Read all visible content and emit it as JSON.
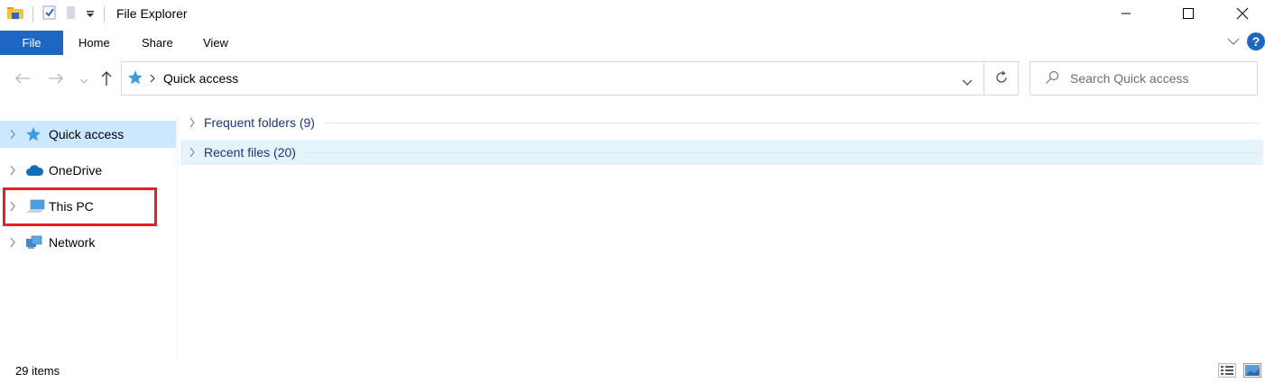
{
  "window": {
    "title": "File Explorer"
  },
  "ribbon": {
    "file": "File",
    "home": "Home",
    "share": "Share",
    "view": "View",
    "help": "?"
  },
  "address": {
    "location": "Quick access"
  },
  "search": {
    "placeholder": "Search Quick access"
  },
  "nav": {
    "items": [
      {
        "label": "Quick access"
      },
      {
        "label": "OneDrive"
      },
      {
        "label": "This PC"
      },
      {
        "label": "Network"
      }
    ]
  },
  "groups": [
    {
      "label": "Frequent folders (9)"
    },
    {
      "label": "Recent files (20)"
    }
  ],
  "status": {
    "items": "29 items"
  },
  "colors": {
    "accent": "#1e66c4",
    "selected": "#cce8ff",
    "highlight_box": "#e3202a",
    "group_text": "#1e3287"
  }
}
